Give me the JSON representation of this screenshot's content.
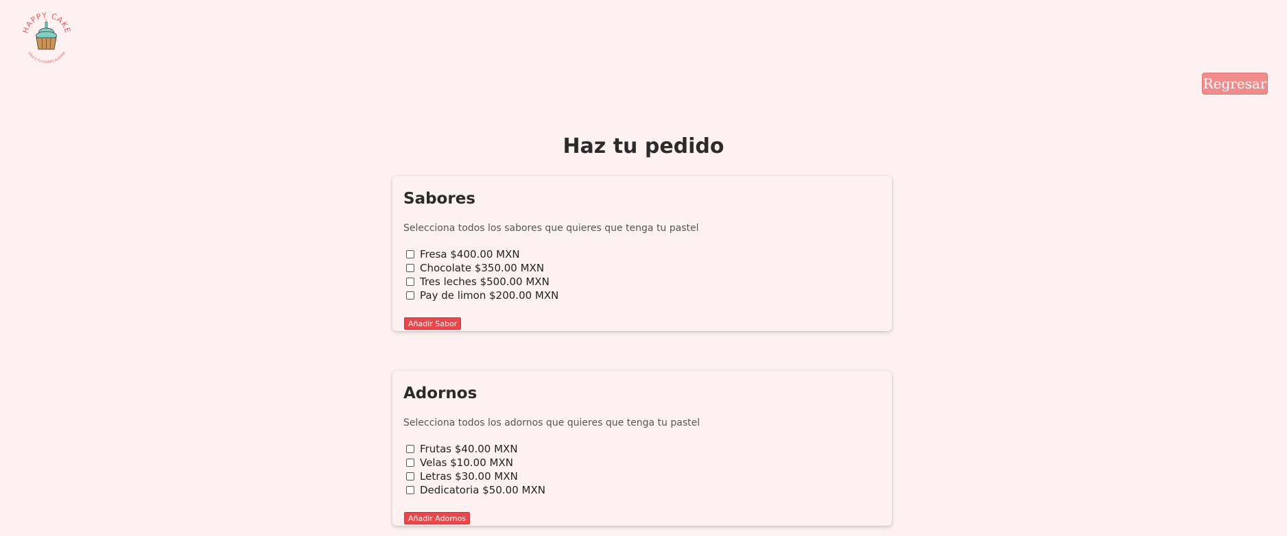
{
  "brand": {
    "logo_text": "HAPPY CAKE",
    "logo_tagline": "DALE A TU CUERPO ALEGRÍA",
    "logo_colors": {
      "text": "#e85a5a",
      "frosting": "#7fcfc4",
      "cup": "#c9935a"
    }
  },
  "header": {
    "back_label": "Regresar"
  },
  "main": {
    "title": "Haz tu pedido"
  },
  "sabores": {
    "title": "Sabores",
    "subtitle": "Selecciona todos los sabores que quieres que tenga tu pastel",
    "options": [
      {
        "label": "Fresa $400.00 MXN",
        "checked": false
      },
      {
        "label": "Chocolate $350.00 MXN",
        "checked": false
      },
      {
        "label": "Tres leches $500.00 MXN",
        "checked": false
      },
      {
        "label": "Pay de limon $200.00 MXN",
        "checked": false
      }
    ],
    "button_label": "Añadir Sabor"
  },
  "adornos": {
    "title": "Adornos",
    "subtitle": "Selecciona todos los adornos que quieres que tenga tu pastel",
    "options": [
      {
        "label": "Frutas $40.00 MXN",
        "checked": false
      },
      {
        "label": "Velas $10.00 MXN",
        "checked": false
      },
      {
        "label": "Letras $30.00 MXN",
        "checked": false
      },
      {
        "label": "Dedicatoria $50.00 MXN",
        "checked": false
      }
    ],
    "button_label": "Añadir Adornos"
  },
  "colors": {
    "background": "#fdf2f1",
    "accent_button": "#e8474b",
    "back_button": "#f08c8c"
  }
}
